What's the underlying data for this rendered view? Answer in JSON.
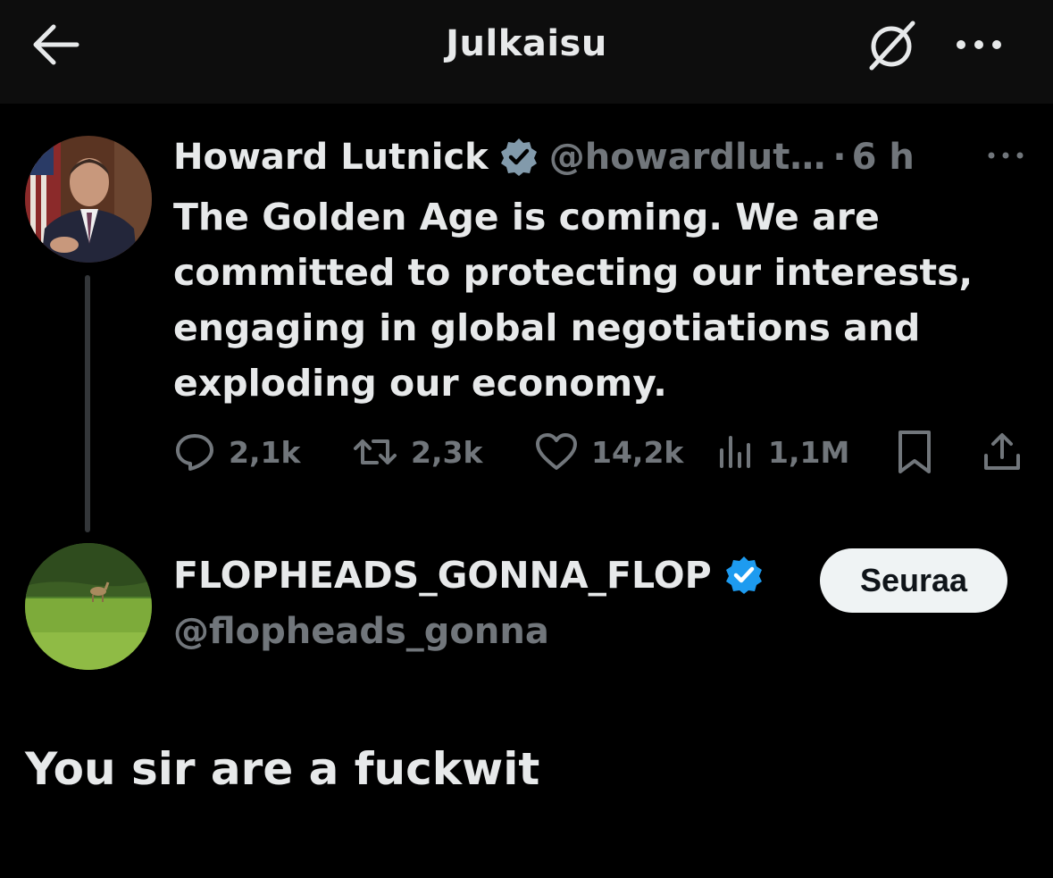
{
  "header": {
    "title": "Julkaisu"
  },
  "original_post": {
    "author_name": "Howard Lutnick",
    "handle": "@howardlut…",
    "separator": "·",
    "time": "6 h",
    "text": "The Golden Age is coming. We are\ncommitted to protecting our interests,\nengaging in global negotiations and\nexploding our economy.",
    "stats": {
      "replies": "2,1k",
      "reposts": "2,3k",
      "likes": "14,2k",
      "views": "1,1M"
    }
  },
  "reply": {
    "author_name": "FLOPHEADS_GONNA_FLOP",
    "handle": "@flopheads_gonna",
    "follow_label": "Seuraa",
    "text": "You sir are a fuckwit"
  },
  "colors": {
    "background": "#000000",
    "header_background": "#0d0d0d",
    "text_primary": "#e7e9ea",
    "text_secondary": "#71767b",
    "verified_blue": "#1d9bf0",
    "verified_gray": "#829aab"
  }
}
